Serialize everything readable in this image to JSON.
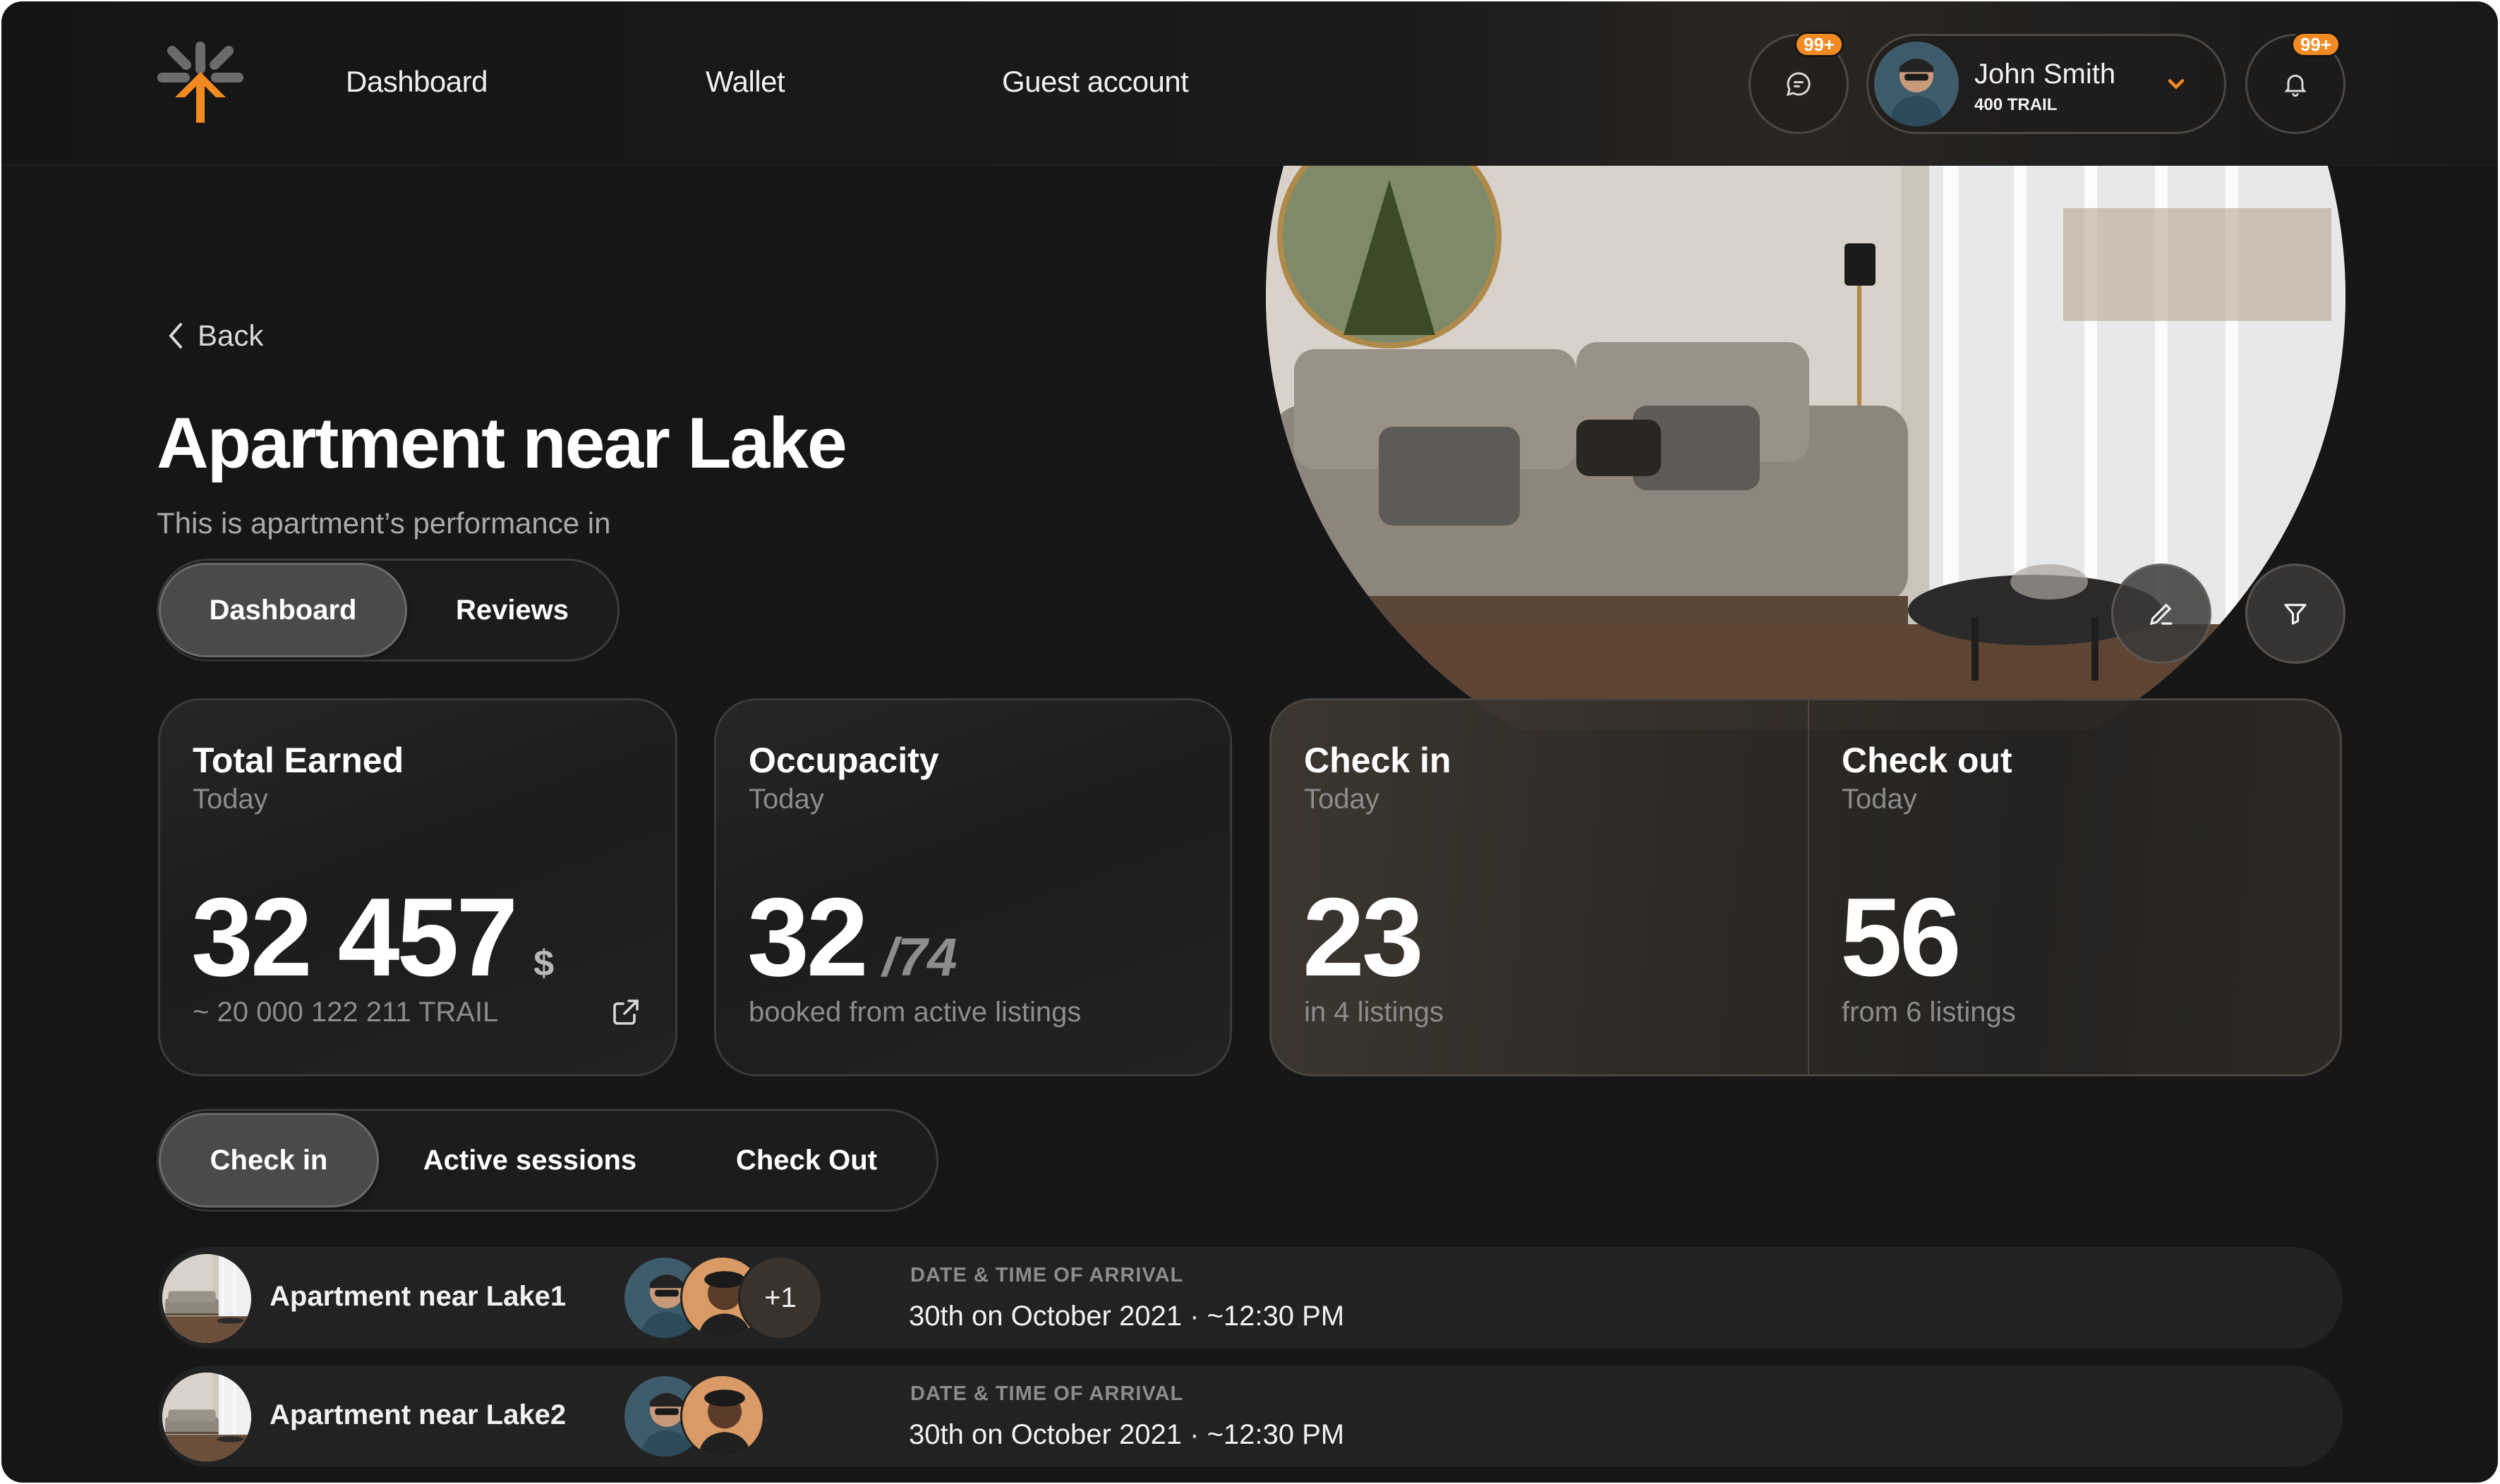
{
  "nav": {
    "links": [
      "Dashboard",
      "Wallet",
      "Guest account"
    ],
    "messages_badge": "99+",
    "notifications_badge": "99+",
    "user": {
      "name": "John Smith",
      "balance": "400 TRAIL"
    }
  },
  "header": {
    "back_label": "Back",
    "title": "Apartment near Lake",
    "subtitle": "This is apartment’s performance in",
    "tabs": [
      "Dashboard",
      "Reviews"
    ],
    "active_tab": "Dashboard"
  },
  "stats": [
    {
      "title": "Total Earned",
      "period": "Today",
      "value": "32 457",
      "unit": "$",
      "footer": "~ 20 000 122 211 TRAIL"
    },
    {
      "title": "Occupacity",
      "period": "Today",
      "value": "32",
      "fraction": "/74",
      "footer": "booked from active listings"
    },
    {
      "title": "Check in",
      "period": "Today",
      "value": "23",
      "footer": "in 4 listings"
    },
    {
      "title": "Check out",
      "period": "Today",
      "value": "56",
      "footer": "from 6 listings"
    }
  ],
  "list": {
    "tabs": [
      "Check in",
      "Active sessions",
      "Check Out"
    ],
    "active_tab": "Check in",
    "rows": [
      {
        "name": "Apartment near Lake1",
        "extra_guests": "+1",
        "label": "DATE & TIME OF ARRIVAL",
        "value": "30th on October 2021 · ~12:30 PM"
      },
      {
        "name": "Apartment near Lake2",
        "extra_guests": "",
        "label": "DATE & TIME OF ARRIVAL",
        "value": "30th on October 2021 · ~12:30 PM"
      }
    ]
  },
  "colors": {
    "accent": "#f28a22",
    "background": "#161616",
    "card": "#222222"
  }
}
